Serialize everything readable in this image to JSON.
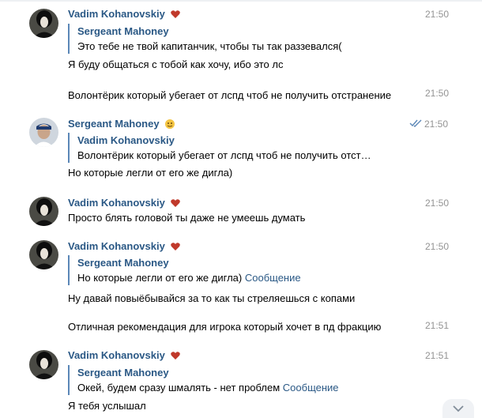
{
  "messages": [
    {
      "author": "Vadim Kohanovskiy",
      "time": "21:50",
      "quote": {
        "author": "Sergeant Mahoney",
        "text": "Это тебе не твой капитанчик, чтобы ты так раззевался("
      },
      "text": "Я буду общаться с тобой как хочу, ибо это лс"
    },
    {
      "text": "Волонтёрик который убегает от лспд чтоб не получить отстранение",
      "time": "21:50"
    },
    {
      "author": "Sergeant Mahoney",
      "time": "21:50",
      "quote": {
        "author": "Vadim Kohanovskiy",
        "text": "Волонтёрик который убегает от лспд чтоб не получить отст…"
      },
      "text": "Но которые легли от его же дигла)"
    },
    {
      "author": "Vadim Kohanovskiy",
      "time": "21:50",
      "text": "Просто блять головой ты даже не умеешь думать"
    },
    {
      "author": "Vadim Kohanovskiy",
      "time": "21:50",
      "quote": {
        "author": "Sergeant Mahoney",
        "text": "Но которые легли от его же дигла)",
        "link": "Сообщение"
      },
      "text": "Ну давай повыёбывайся за то как ты стреляешься с копами"
    },
    {
      "text": "Отличная рекомендация для игрока который хочет в пд фракцию",
      "time": "21:51"
    },
    {
      "author": "Vadim Kohanovskiy",
      "time": "21:51",
      "quote": {
        "author": "Sergeant Mahoney",
        "text": "Окей, будем сразу шмалять - нет проблем",
        "link": "Сообщение"
      },
      "text": "Я тебя услышал"
    }
  ],
  "icons": {
    "author_badge_vadim": "heart-emoji-icon",
    "author_badge_sergeant": "emoji-icon",
    "read_receipt": "double-check-icon",
    "scroll_down": "chevron-down-icon"
  },
  "colors": {
    "author": "#2a5885",
    "quote_bar": "#5b87b7",
    "time": "#939393",
    "link": "#2a5885"
  }
}
